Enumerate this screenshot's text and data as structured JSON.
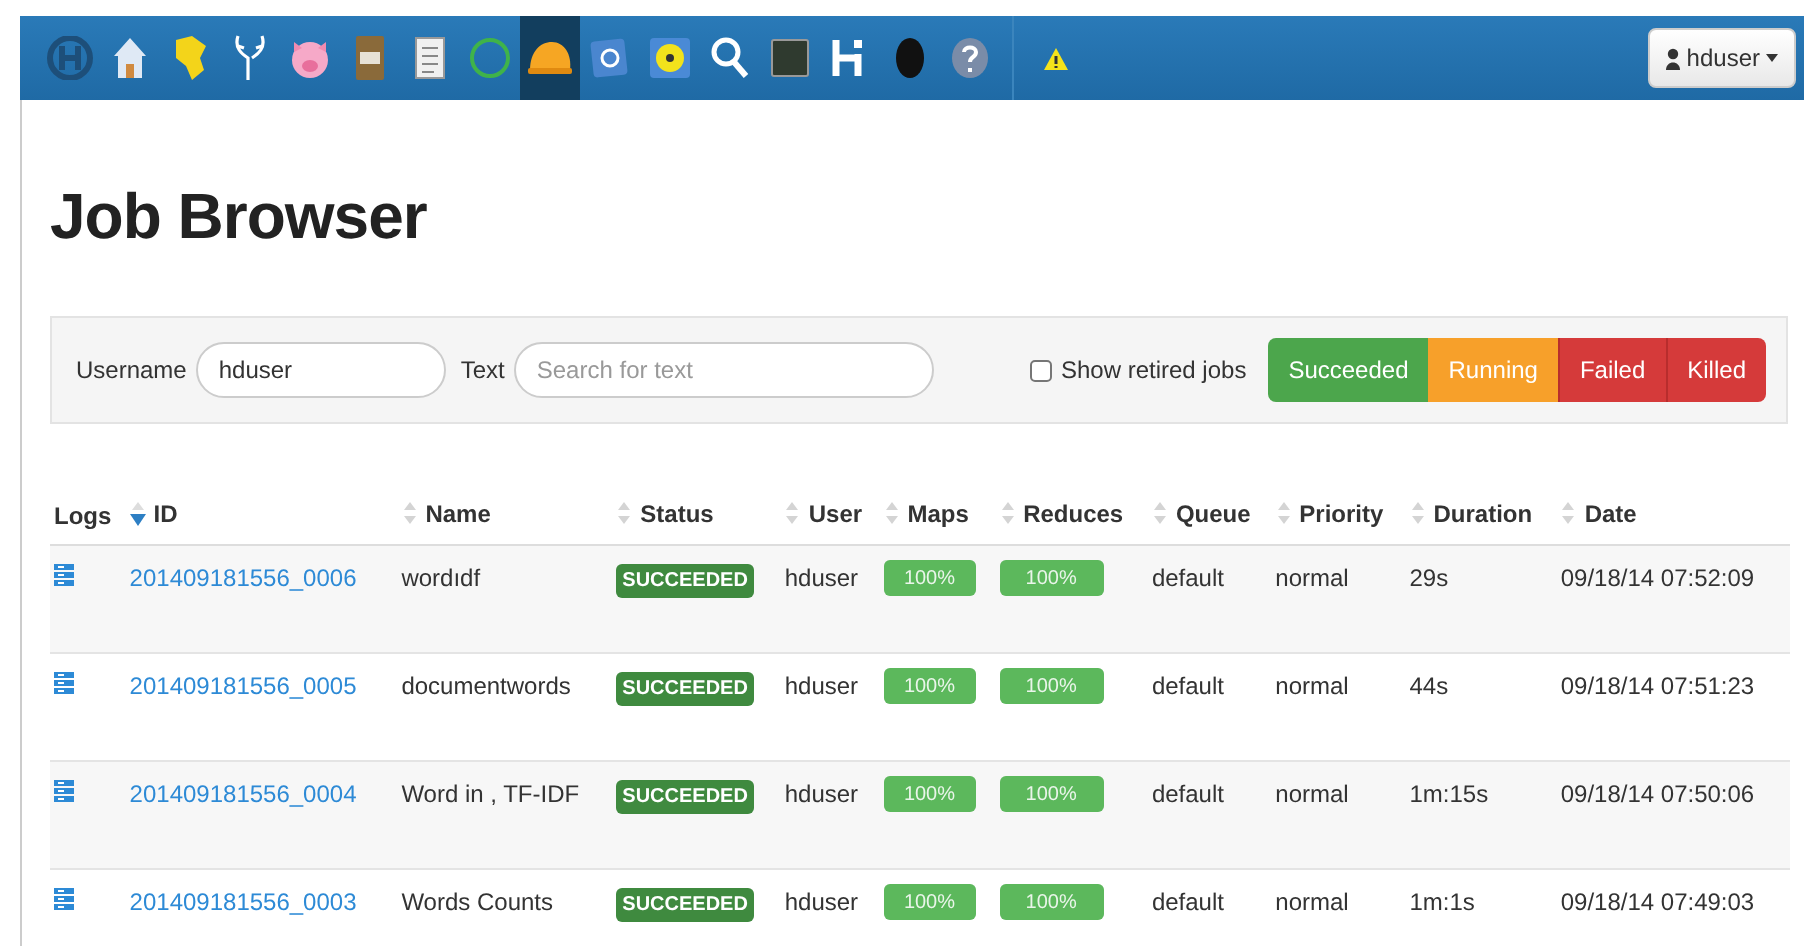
{
  "navbar": {
    "items": [
      {
        "kind": "logo",
        "selected": false
      },
      {
        "kind": "house",
        "selected": false
      },
      {
        "kind": "blob",
        "selected": false
      },
      {
        "kind": "antlers",
        "selected": false
      },
      {
        "kind": "pig",
        "selected": false
      },
      {
        "kind": "cabinet",
        "selected": false
      },
      {
        "kind": "document",
        "selected": false
      },
      {
        "kind": "ring",
        "selected": false
      },
      {
        "kind": "helmet",
        "selected": true
      },
      {
        "kind": "blue-square",
        "selected": false
      },
      {
        "kind": "disc",
        "selected": false
      },
      {
        "kind": "search",
        "selected": false
      },
      {
        "kind": "monitor",
        "selected": false
      },
      {
        "kind": "letter-h",
        "selected": false
      },
      {
        "kind": "head",
        "selected": false
      },
      {
        "kind": "help",
        "selected": false
      }
    ],
    "alert": {
      "kind": "warning"
    },
    "user_menu": {
      "label": "hduser"
    }
  },
  "page_title": "Job Browser",
  "filters": {
    "username": {
      "label": "Username",
      "value": "hduser"
    },
    "text": {
      "label": "Text",
      "placeholder": "Search for text"
    },
    "show_retired": {
      "label": "Show retired jobs",
      "checked": false
    },
    "status_buttons": [
      {
        "label": "Succeeded",
        "kind": "succeeded"
      },
      {
        "label": "Running",
        "kind": "running"
      },
      {
        "label": "Failed",
        "kind": "failed"
      },
      {
        "label": "Killed",
        "kind": "killed"
      }
    ]
  },
  "table": {
    "columns": [
      {
        "label": "Logs"
      },
      {
        "label": "ID",
        "sorted": true
      },
      {
        "label": "Name",
        "sorted": false
      },
      {
        "label": "Status",
        "sorted": false
      },
      {
        "label": "User",
        "sorted": false
      },
      {
        "label": "Maps",
        "sorted": false
      },
      {
        "label": "Reduces",
        "sorted": false
      },
      {
        "label": "Queue",
        "sorted": false
      },
      {
        "label": "Priority",
        "sorted": false
      },
      {
        "label": "Duration",
        "sorted": false
      },
      {
        "label": "Date",
        "sorted": false
      }
    ],
    "rows": [
      {
        "id": "201409181556_0006",
        "name": "wordıdf",
        "status": "SUCCEEDED",
        "user": "hduser",
        "maps": {
          "text": "100%",
          "level": 1
        },
        "reduces": {
          "text": "100%",
          "level": 1
        },
        "queue": "default",
        "priority": "normal",
        "duration": "29s",
        "date": "09/18/14 07:52:09"
      },
      {
        "id": "201409181556_0005",
        "name": "documentwords",
        "status": "SUCCEEDED",
        "user": "hduser",
        "maps": {
          "text": "100%",
          "level": 1
        },
        "reduces": {
          "text": "100%",
          "level": 1
        },
        "queue": "default",
        "priority": "normal",
        "duration": "44s",
        "date": "09/18/14 07:51:23"
      },
      {
        "id": "201409181556_0004",
        "name": "Word in , TF-IDF",
        "status": "SUCCEEDED",
        "user": "hduser",
        "maps": {
          "text": "100%",
          "level": 1
        },
        "reduces": {
          "text": "100%",
          "level": 1
        },
        "queue": "default",
        "priority": "normal",
        "duration": "1m:15s",
        "date": "09/18/14 07:50:06"
      },
      {
        "id": "201409181556_0003",
        "name": "Words Counts",
        "status": "SUCCEEDED",
        "user": "hduser",
        "maps": {
          "text": "100%",
          "level": 1
        },
        "reduces": {
          "text": "100%",
          "level": 1
        },
        "queue": "default",
        "priority": "normal",
        "duration": "1m:1s",
        "date": "09/18/14 07:49:03"
      }
    ]
  }
}
